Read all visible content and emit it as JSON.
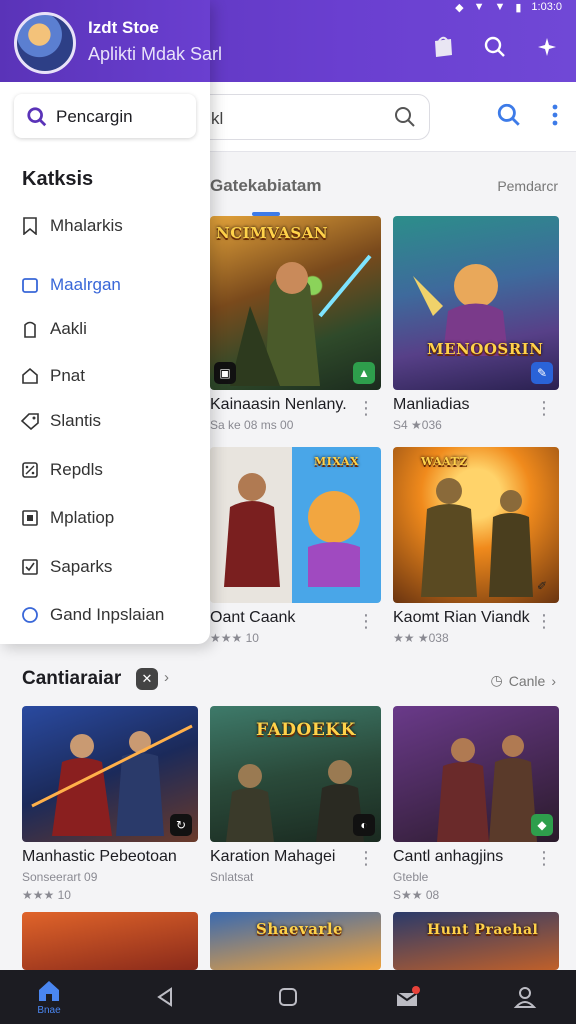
{
  "status": {
    "time": "1:03:0",
    "icons": [
      "signal-icon",
      "wifi-icon",
      "battery-icon"
    ]
  },
  "drawer": {
    "title": "Izdt Stoe",
    "subtitle": "Aplikti Mdak Sarl",
    "search_label": "Pencargin",
    "heading": "Katksis",
    "items": [
      {
        "label": "Mhalarkis",
        "icon": "bookmark-icon"
      },
      {
        "label": "Maalrgan",
        "icon": "square-icon",
        "active": true
      },
      {
        "label": "Aakli",
        "icon": "door-icon"
      },
      {
        "label": "Pnat",
        "icon": "home-icon"
      },
      {
        "label": "Slantis",
        "icon": "tag-icon"
      },
      {
        "label": "Repdls",
        "icon": "percent-icon"
      },
      {
        "label": "Mplatiop",
        "icon": "box-icon"
      },
      {
        "label": "Saparks",
        "icon": "check-box-icon"
      },
      {
        "label": "Gand Inpslaian",
        "icon": "circle-icon"
      }
    ]
  },
  "search": {
    "query": "kl"
  },
  "section1": {
    "title": "Gatekabiatam",
    "link": "Pemdarcr"
  },
  "section2": {
    "title": "Cantiaraiar",
    "link": "Canle"
  },
  "grid1": [
    {
      "name": "Kainaasin Nenlany.",
      "sub": "Sa ke 08 ms 00",
      "art_title": "NCIMVASAN"
    },
    {
      "name": "Manliadias",
      "sub": "S4 ★036",
      "art_title": "MENOOSRIN"
    },
    {
      "name": "Oant Caank",
      "sub": "★★★ 10",
      "art_title": ""
    },
    {
      "name": "Kaomt Rian Viandk",
      "sub": "★★ ★038",
      "art_title": ""
    }
  ],
  "grid2": [
    {
      "name": "Manhastic Pebeotoan",
      "sub": "Sonseerart 09",
      "sub2": "★★★ 10",
      "art_title": ""
    },
    {
      "name": "Karation Mahagei",
      "sub": "Snlatsat",
      "art_title": "FADOEKK"
    },
    {
      "name": "Cantl anhagjins",
      "sub": "Gteble",
      "sub2": "S★★ 08",
      "art_title": ""
    }
  ],
  "grid3": [
    {
      "art_title": ""
    },
    {
      "art_title": "Shaevarle"
    },
    {
      "art_title": "Hunt Praehal"
    }
  ],
  "bottom_nav": {
    "home_label": "Bnae"
  },
  "colors": {
    "primary": "#6a3fd0",
    "accent": "#3d7be8",
    "active_item": "#3967d8"
  }
}
